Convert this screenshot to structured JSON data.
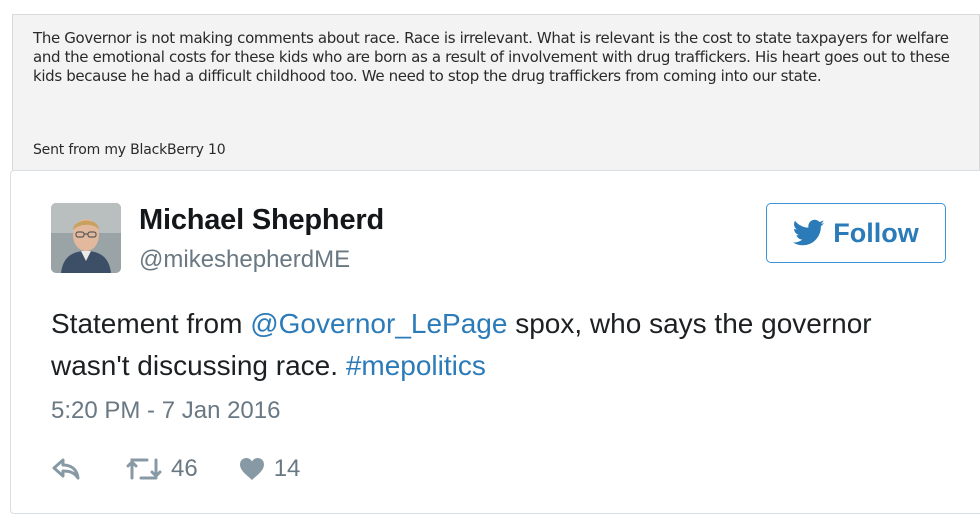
{
  "email": {
    "body": "The Governor is not making comments about race. Race is irrelevant. What is relevant is the cost to state taxpayers for welfare and the emotional costs for these kids who are born as a result of involvement with drug traffickers. His heart goes out to these kids because he had a difficult childhood too. We need to stop the drug traffickers from coming into our state.",
    "signature": "Sent from my BlackBerry 10"
  },
  "tweet": {
    "author_name": "Michael Shepherd",
    "author_handle": "@mikeshepherdME",
    "follow_label": "Follow",
    "text_part1": "Statement from ",
    "mention": "@Governor_LePage",
    "text_part2": " spox, who says the governor wasn't discussing race. ",
    "hashtag": "#mepolitics",
    "timestamp": "5:20 PM - 7 Jan 2016",
    "retweet_count": "46",
    "like_count": "14"
  },
  "colors": {
    "link": "#2b7bb9",
    "follow_border": "#3b94d9",
    "muted": "#697882",
    "icon": "#8899a6"
  },
  "icons": {
    "follow": "twitter-bird-icon",
    "reply": "reply-icon",
    "retweet": "retweet-icon",
    "like": "heart-icon"
  }
}
